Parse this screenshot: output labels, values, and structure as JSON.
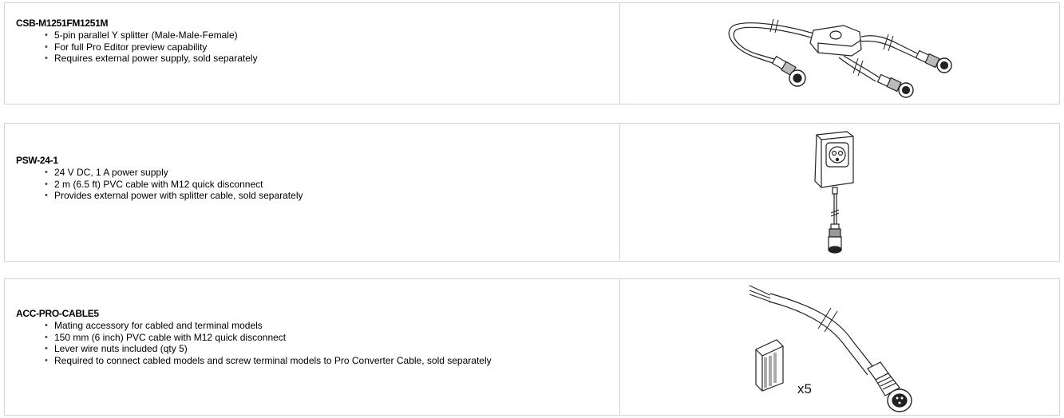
{
  "products": [
    {
      "model": "CSB-M1251FM1251M",
      "features": [
        "5-pin parallel Y splitter (Male-Male-Female)",
        "For full Pro Editor preview capability",
        "Requires external power supply, sold separately"
      ],
      "image_icon": "y-splitter-cable-icon"
    },
    {
      "model": "PSW-24-1",
      "features": [
        "24 V DC, 1 A power supply",
        "2 m (6.5 ft) PVC cable with M12 quick disconnect",
        "Provides external power with splitter cable, sold separately"
      ],
      "image_icon": "power-supply-icon"
    },
    {
      "model": "ACC-PRO-CABLE5",
      "features": [
        "Mating accessory for cabled and terminal models",
        "150 mm (6 inch) PVC cable with M12 quick disconnect",
        "Lever wire nuts included (qty 5)",
        "Required to connect cabled models and screw terminal models to Pro Converter Cable, sold separately"
      ],
      "image_icon": "cable-with-wire-nuts-icon",
      "image_caption": "x5"
    }
  ]
}
